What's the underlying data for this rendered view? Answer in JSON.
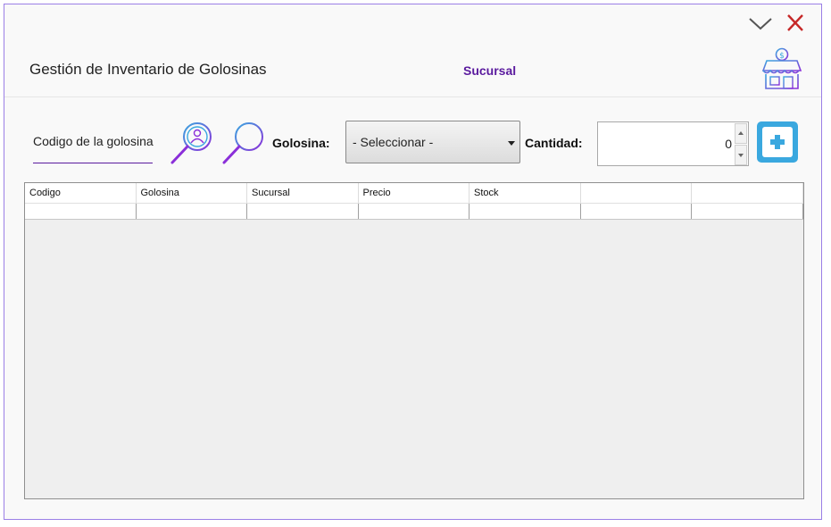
{
  "window": {
    "title": "Gestión de Inventario de Golosinas",
    "branch_label": "Sucursal"
  },
  "controls": {
    "minimize_icon": "chevron-down-icon",
    "close_icon": "close-icon"
  },
  "toolbar": {
    "code_label": "Codigo de la golosina",
    "golosina_label": "Golosina:",
    "golosina_selected": "- Seleccionar -",
    "cantidad_label": "Cantidad:",
    "cantidad_value": "0"
  },
  "table": {
    "columns": [
      "Codigo",
      "Golosina",
      "Sucursal",
      "Precio",
      "Stock",
      "",
      ""
    ]
  },
  "colors": {
    "accent": "#5a1a9e",
    "border": "#9b7fe6",
    "close": "#c62828",
    "add_button": "#3aa8df"
  }
}
